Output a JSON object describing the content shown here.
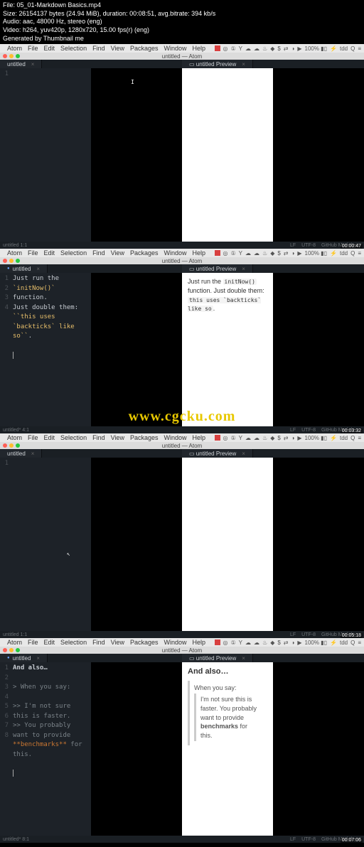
{
  "media": {
    "file": "File: 05_01-Markdown Basics.mp4",
    "size": "Size: 26154137 bytes (24.94 MiB), duration: 00:08:51, avg.bitrate: 394 kb/s",
    "audio": "Audio: aac, 48000 Hz, stereo (eng)",
    "video": "Video: h264, yuv420p, 1280x720, 15.00 fps(r) (eng)",
    "gen": "Generated by Thumbnail me"
  },
  "menu": {
    "apple": "",
    "items": [
      "Atom",
      "File",
      "Edit",
      "Selection",
      "Find",
      "View",
      "Packages",
      "Window",
      "Help"
    ],
    "right": [
      "◎",
      "①",
      "Υ",
      "☁",
      "☁",
      "♨",
      "◆",
      "$",
      "⇄",
      "◑",
      "▶",
      "100% ▮▯",
      "⚡",
      "tdd",
      "Q",
      "≡"
    ]
  },
  "window": {
    "title": "untitled — Atom"
  },
  "tabs": {
    "editor": "untitled",
    "preview": "untitled Preview",
    "previewIcon": "▭"
  },
  "frame1": {
    "gut": [
      "1"
    ],
    "lines": [
      ""
    ],
    "status": {
      "left": "untitled   1:1",
      "right": [
        "LF",
        "UTF-8",
        "GitHub Markdown"
      ],
      "ts": "00:00:47"
    }
  },
  "frame2": {
    "gut": [
      "1",
      "2",
      "3",
      "4"
    ],
    "lines": [
      {
        "pre": "Just run the ",
        "s": "`initNow()`",
        "post": " function."
      },
      {
        "pre": "Just double them: ",
        "s": "``this uses `backticks` like so``",
        "post": "."
      },
      {
        "pre": "",
        "s": "",
        "post": ""
      },
      {
        "pre": "",
        "s": "",
        "post": ""
      }
    ],
    "preview": {
      "p1_a": "Just run the ",
      "p1_code": "initNow()",
      "p1_b": " function. Just double them: ",
      "p1_code2": "this uses `backticks` like so",
      "p1_c": "."
    },
    "status": {
      "left": "untitled*   4:1",
      "right": [
        "LF",
        "UTF-8",
        "GitHub Markdown"
      ],
      "ts": "00:03:32"
    }
  },
  "watermark": "www.cgcku.com",
  "frame3": {
    "gut": [
      "1"
    ],
    "lines": [
      ""
    ],
    "status": {
      "left": "untitled   1:1",
      "right": [
        "LF",
        "UTF-8",
        "GitHub Markdown"
      ],
      "ts": "00:05:18"
    }
  },
  "frame4": {
    "gut": [
      "1",
      "2",
      "3",
      "4",
      "5",
      "6",
      "7",
      "8"
    ],
    "lines": [
      {
        "t": "And also…",
        "cls": "h1l"
      },
      {
        "t": ""
      },
      {
        "t": "> When you say:",
        "cls": "quote"
      },
      {
        "t": ""
      },
      {
        "t": ">> I'm not sure this is faster.",
        "cls": "quote"
      },
      {
        "pre": ">> You probably want to provide ",
        "b": "**benchmarks**",
        "post": " for this.",
        "cls": "quote"
      },
      {
        "t": ""
      },
      {
        "t": ""
      }
    ],
    "preview": {
      "h1": "And also…",
      "q1": "When you say:",
      "q2a": "I'm not sure this is faster. You probably want to provide ",
      "q2b": "benchmarks",
      "q2c": " for this."
    },
    "status": {
      "left": "untitled*   8:1",
      "right": [
        "LF",
        "UTF-8",
        "GitHub Markdown"
      ],
      "ts": "00:07:06"
    }
  }
}
